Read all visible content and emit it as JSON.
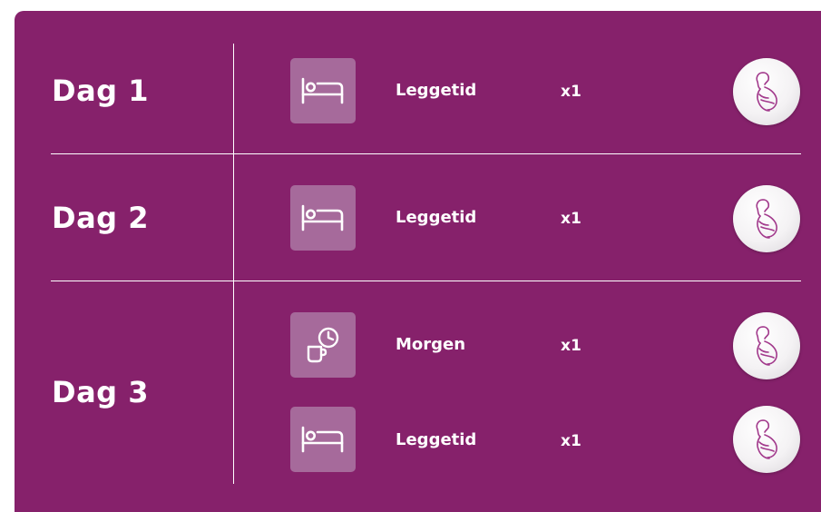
{
  "colors": {
    "panel": "#86216b",
    "icon_tile": "#a66a9b",
    "text": "#ffffff",
    "avatar_line": "#a23a8c"
  },
  "days": [
    {
      "label": "Dag 1",
      "items": [
        {
          "icon": "bed-icon",
          "label": "Leggetid",
          "count": "x1"
        }
      ]
    },
    {
      "label": "Dag 2",
      "items": [
        {
          "icon": "bed-icon",
          "label": "Leggetid",
          "count": "x1"
        }
      ]
    },
    {
      "label": "Dag 3",
      "items": [
        {
          "icon": "mug-clock-icon",
          "label": "Morgen",
          "count": "x1"
        },
        {
          "icon": "bed-icon",
          "label": "Leggetid",
          "count": "x1"
        }
      ]
    }
  ]
}
